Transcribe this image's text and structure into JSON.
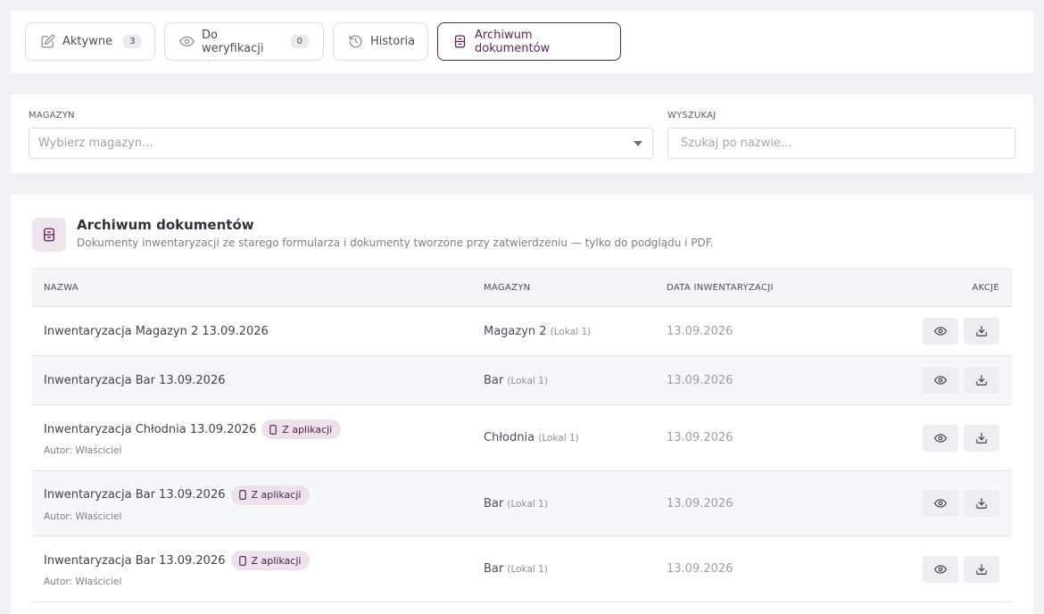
{
  "tabs": [
    {
      "label": "Aktywne",
      "count": "3"
    },
    {
      "label": "Do weryfikacji",
      "count": "0"
    },
    {
      "label": "Historia"
    },
    {
      "label": "Archiwum dokumentów"
    }
  ],
  "filters": {
    "warehouse_label": "MAGAZYN",
    "warehouse_placeholder": "Wybierz magazyn...",
    "search_label": "WYSZUKAJ",
    "search_placeholder": "Szukaj po nazwie..."
  },
  "archive": {
    "title": "Archiwum dokumentów",
    "subtitle": "Dokumenty inwentaryzacji ze starego formularza i dokumenty tworzone przy zatwierdzeniu — tylko do podglądu i PDF.",
    "columns": {
      "name": "NAZWA",
      "warehouse": "MAGAZYN",
      "date": "DATA INWENTARYZACJI",
      "actions": "AKCJE"
    },
    "rows": [
      {
        "name": "Inwentaryzacja Magazyn 2 13.09.2026",
        "warehouse": "Magazyn 2",
        "location": "(Lokal 1)",
        "date": "13.09.2026"
      },
      {
        "name": "Inwentaryzacja Bar 13.09.2026",
        "warehouse": "Bar",
        "location": "(Lokal 1)",
        "date": "13.09.2026"
      },
      {
        "name": "Inwentaryzacja Chłodnia 13.09.2026",
        "badge": "Z aplikacji",
        "author": "Autor: Właściciel",
        "warehouse": "Chłodnia",
        "location": "(Lokal 1)",
        "date": "13.09.2026"
      },
      {
        "name": "Inwentaryzacja Bar 13.09.2026",
        "badge": "Z aplikacji",
        "author": "Autor: Właściciel",
        "warehouse": "Bar",
        "location": "(Lokal 1)",
        "date": "13.09.2026"
      },
      {
        "name": "Inwentaryzacja Bar 13.09.2026",
        "badge": "Z aplikacji",
        "author": "Autor: Właściciel",
        "warehouse": "Bar",
        "location": "(Lokal 1)",
        "date": "13.09.2026"
      }
    ]
  },
  "icons": {
    "tab_active": "edit-icon",
    "tab_verify": "eye-icon",
    "tab_history": "history-icon",
    "tab_archive": "archive-icon",
    "row_view": "eye-icon",
    "row_download": "download-icon",
    "badge": "smartphone-icon"
  },
  "colors": {
    "accent": "#5e1f59",
    "badge_bg": "#efe0ed",
    "icon_bg": "#efe3ee"
  }
}
